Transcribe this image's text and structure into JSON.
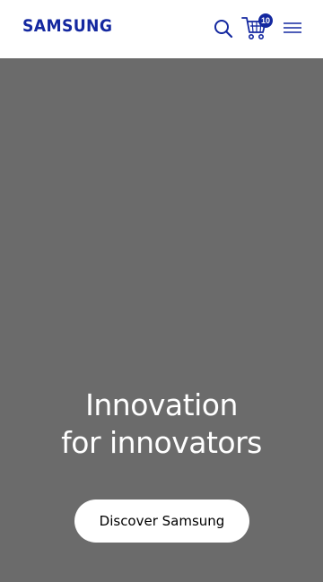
{
  "header": {
    "logo_text": "SAMSUNG",
    "cart_count": "10",
    "icons": {
      "search": "search-icon",
      "cart": "cart-icon",
      "menu": "menu-icon"
    }
  },
  "hero": {
    "headline_line1": "Innovation",
    "headline_line2": "for innovators",
    "cta_label": "Discover Samsung"
  },
  "colors": {
    "brand": "#1428a0",
    "hero_background": "#6b6b6b",
    "header_background": "#ffffff",
    "cta_background": "#ffffff"
  }
}
